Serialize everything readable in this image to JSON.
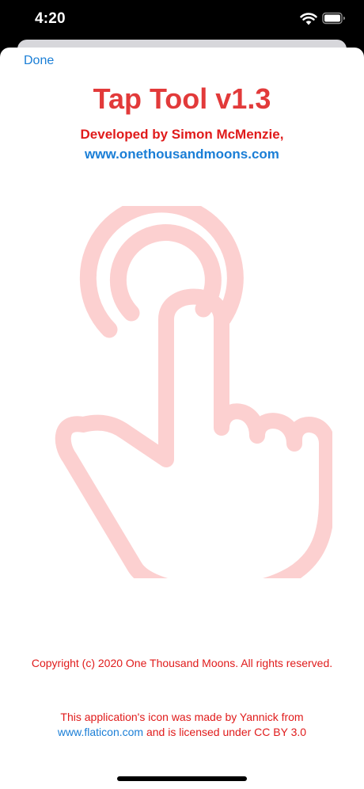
{
  "status_bar": {
    "time": "4:20",
    "wifi_icon": "wifi-icon",
    "battery_icon": "battery-icon"
  },
  "nav": {
    "done_label": "Done"
  },
  "about": {
    "title": "Tap Tool v1.3",
    "developer": "Developed by Simon McMenzie,",
    "website": "www.onethousandmoons.com",
    "illustration_icon": "tap-hand-icon",
    "copyright": "Copyright (c) 2020 One Thousand Moons. All rights reserved.",
    "credit_line1": "This application's icon was made by Yannick from",
    "credit_link": "www.flaticon.com",
    "credit_line2_rest": " and is licensed under CC BY 3.0"
  },
  "colors": {
    "title_red": "#e23a3a",
    "text_red": "#e01b1b",
    "link_blue": "#1a7ed6",
    "illustration_pink": "#fcd0d0"
  }
}
